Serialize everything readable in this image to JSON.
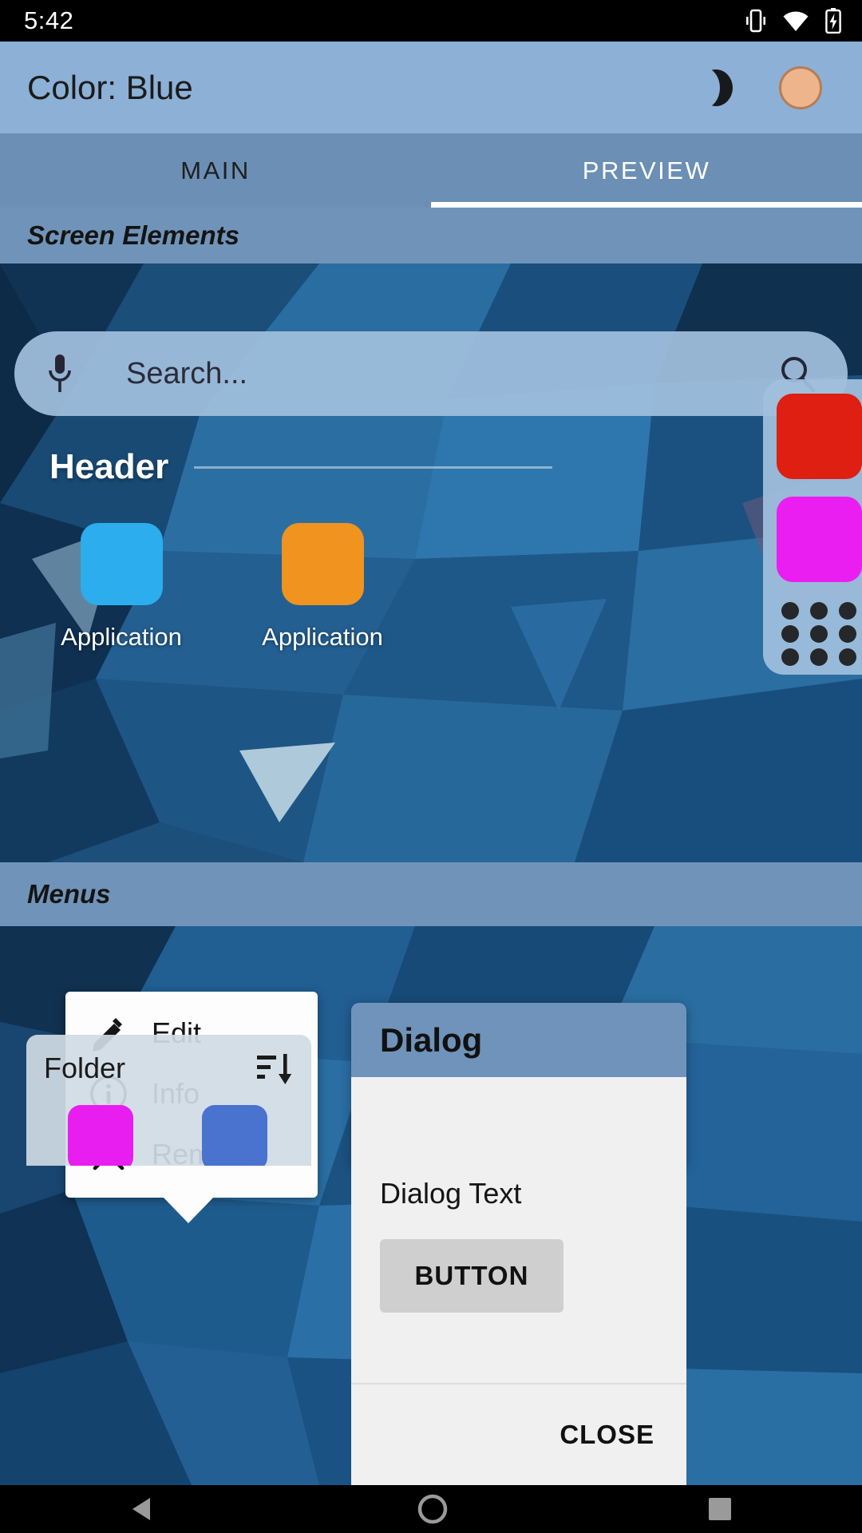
{
  "status_bar": {
    "time": "5:42",
    "icons": [
      "vibrate-icon",
      "wifi-icon",
      "battery-charging-icon"
    ]
  },
  "app_bar": {
    "title": "Color: Blue",
    "dark_mode_icon": "moon-icon",
    "color_swatch": "#eeb48b"
  },
  "tabs": [
    {
      "label": "MAIN",
      "active": false
    },
    {
      "label": "PREVIEW",
      "active": true
    }
  ],
  "sections": {
    "screen_elements": "Screen Elements",
    "menus": "Menus"
  },
  "search": {
    "placeholder": "Search...",
    "mic_icon": "microphone-icon",
    "search_icon": "search-icon"
  },
  "home": {
    "header_label": "Header",
    "apps": [
      {
        "label": "Application",
        "color": "#2badee"
      },
      {
        "label": "Application",
        "color": "#f0931f"
      }
    ],
    "dock": {
      "tiles": [
        {
          "color": "#de1f12"
        },
        {
          "color": "#ea1ef0"
        }
      ],
      "drawer_icon": "app-grid-icon"
    }
  },
  "popup_menu": {
    "items": [
      {
        "label": "Edit",
        "icon": "pencil-icon"
      },
      {
        "label": "Info",
        "icon": "info-circle-icon"
      },
      {
        "label": "Remove",
        "icon": "close-x-icon"
      }
    ]
  },
  "folder": {
    "title": "Folder",
    "sort_icon": "sort-descending-icon",
    "items": [
      {
        "color": "#e81ef0"
      },
      {
        "color": "#4a72cf"
      }
    ]
  },
  "dialog": {
    "title": "Dialog",
    "text": "Dialog Text",
    "button_label": "BUTTON",
    "close_label": "CLOSE"
  },
  "nav_bar": {
    "back_icon": "back-triangle-icon",
    "home_icon": "home-circle-icon",
    "recents_icon": "recents-square-icon"
  }
}
